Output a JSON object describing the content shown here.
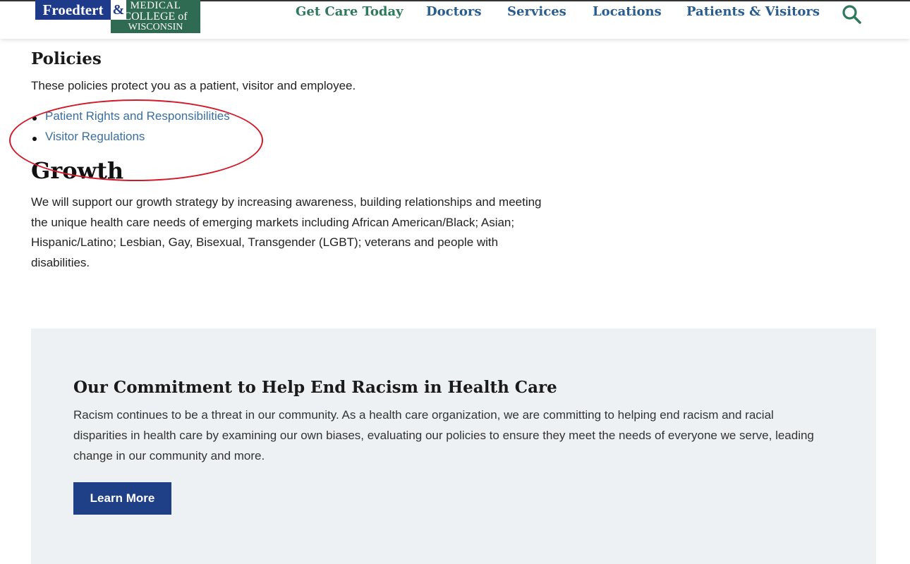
{
  "header": {
    "logo": {
      "left_text": "Froedtert",
      "ampersand": "&",
      "right_line1": "MEDICAL",
      "right_line2": "COLLEGE of",
      "right_line3": "WISCONSIN"
    },
    "nav": [
      {
        "label": "Get Care Today"
      },
      {
        "label": "Doctors"
      },
      {
        "label": "Services"
      },
      {
        "label": "Locations"
      },
      {
        "label": "Patients & Visitors"
      }
    ],
    "search_icon": "search-icon"
  },
  "policies": {
    "heading": "Policies",
    "intro": "These policies protect you as a patient, visitor and employee.",
    "links": [
      {
        "label": "Patient Rights and Responsibilities"
      },
      {
        "label": "Visitor Regulations"
      }
    ]
  },
  "growth": {
    "heading": "Growth",
    "body": "We will support our growth strategy by increasing awareness, building relationships and meeting the unique health care needs of emerging markets including African American/Black; Asian; Hispanic/Latino; Lesbian, Gay, Bisexual, Transgender (LGBT); veterans and people with disabilities."
  },
  "callout": {
    "title": "Our Commitment to Help End Racism in Health Care",
    "body": "Racism continues to be a threat in our community. As a health care organization, we are committing to helping end racism and racial disparities in health care by examining our own biases, evaluating our policies to ensure they meet the needs of everyone we serve, leading change in our community and more.",
    "button_label": "Learn More"
  },
  "colors": {
    "nav_green": "#2f7a5c",
    "nav_blue": "#2a5d8f",
    "link_blue": "#3a6f9f",
    "button_bg": "#1f3f86",
    "callout_bg": "#eef1f4",
    "annotation_red": "#d11a2a"
  }
}
